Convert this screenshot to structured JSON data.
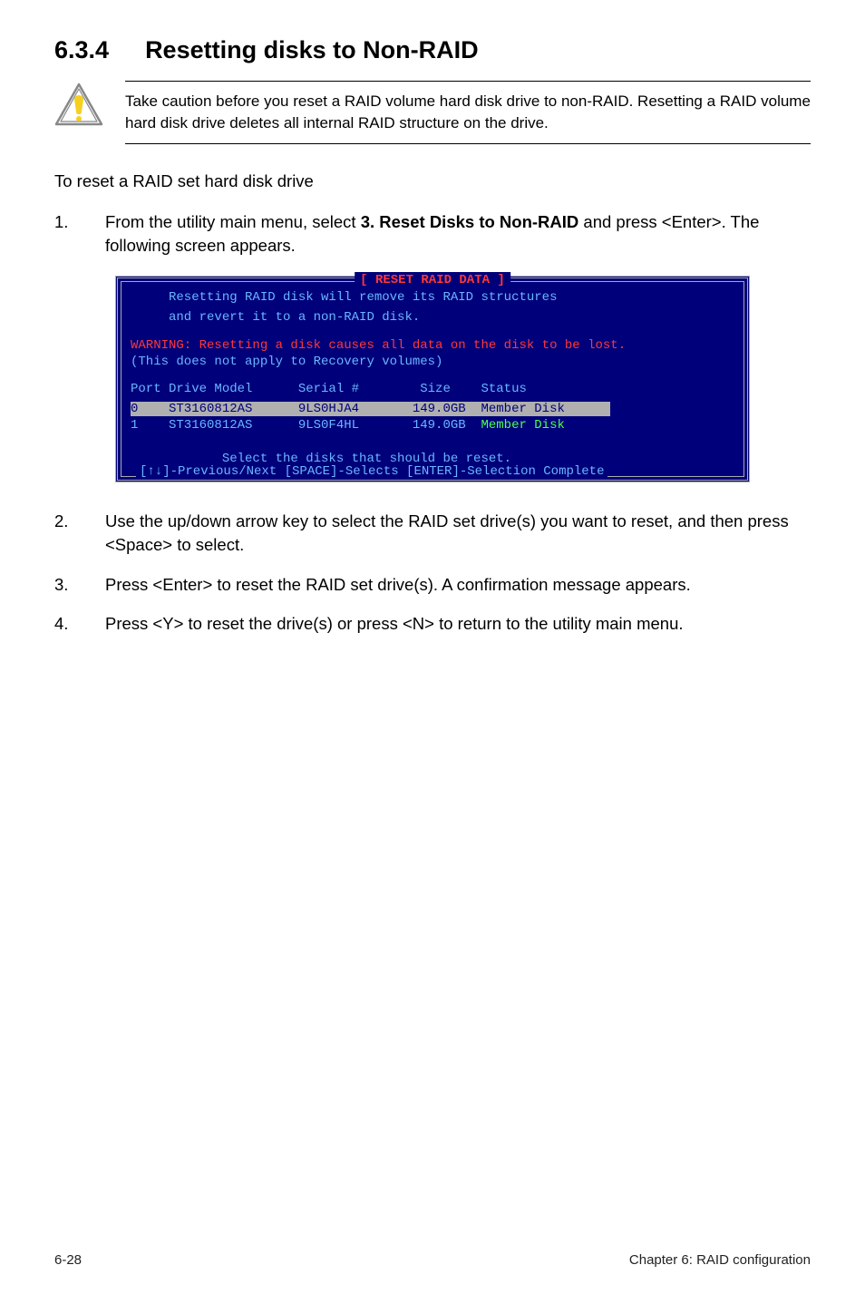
{
  "heading": {
    "number": "6.3.4",
    "title": "Resetting disks to Non-RAID"
  },
  "caution": {
    "text": "Take caution before you reset a RAID volume hard disk drive to non-RAID. Resetting a RAID volume hard disk drive deletes all internal RAID structure on the drive."
  },
  "intro": "To reset a RAID set hard disk drive",
  "step1": {
    "pre": "From the utility main menu, select ",
    "bold": "3. Reset Disks to Non-RAID",
    "post": " and press <Enter>. The following screen appears."
  },
  "terminal": {
    "title": "[ RESET RAID DATA ]",
    "line1": "     Resetting RAID disk will remove its RAID structures",
    "line2": "     and revert it to a non-RAID disk.",
    "warning": "WARNING: Resetting a disk causes all data on the disk to be lost.",
    "recovery": "(This does not apply to Recovery volumes)",
    "header": "Port Drive Model      Serial #        Size    Status",
    "row0_sel": "0    ST3160812AS      9LS0HJA4       149.0GB ",
    "row0_status": " Member Disk      ",
    "row1_pre": "1    ST3160812AS      9LS0F4HL       149.0GB  ",
    "row1_status": "Member Disk",
    "select": "            Select the disks that should be reset.",
    "nav": "[↑↓]-Previous/Next  [SPACE]-Selects [ENTER]-Selection Complete"
  },
  "step2": "Use the up/down arrow key to select the RAID set drive(s) you want to reset, and then press <Space> to select.",
  "step3": "Press <Enter> to reset the RAID set drive(s). A confirmation message appears.",
  "step4": "Press <Y> to reset the drive(s) or press <N> to return to the utility main menu.",
  "footer": {
    "page": "6-28",
    "chapter": "Chapter 6: RAID configuration"
  }
}
